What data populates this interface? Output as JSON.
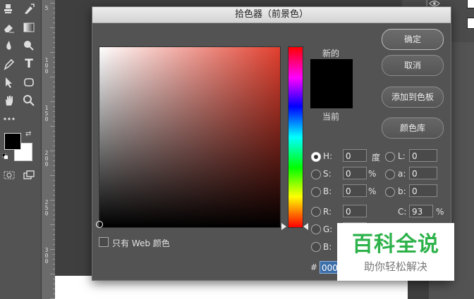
{
  "dialog": {
    "title": "拾色器（前景色）",
    "new_label": "新的",
    "current_label": "当前",
    "buttons": {
      "ok": "确定",
      "cancel": "取消",
      "add_swatches": "添加到色板",
      "color_libraries": "颜色库"
    },
    "web_colors_only": "只有 Web 颜色",
    "hsb": [
      {
        "label": "H:",
        "value": "0",
        "unit": "度",
        "selected": true
      },
      {
        "label": "S:",
        "value": "0",
        "unit": "%",
        "selected": false
      },
      {
        "label": "B:",
        "value": "0",
        "unit": "%",
        "selected": false
      }
    ],
    "lab": [
      {
        "label": "L:",
        "value": "0"
      },
      {
        "label": "a:",
        "value": "0"
      },
      {
        "label": "b:",
        "value": "0"
      }
    ],
    "rgb": [
      {
        "label": "R:",
        "value": "0"
      },
      {
        "label": "G:",
        "value": ""
      },
      {
        "label": "B:",
        "value": ""
      }
    ],
    "cmyk": [
      {
        "label": "C:",
        "value": "93",
        "unit": "%"
      }
    ],
    "hex_label": "#",
    "hex_value": "0000",
    "colors": {
      "foreground": "#000000",
      "hue_base": "#e23f2e"
    }
  },
  "ruler": {
    "numbers": [
      "5",
      "1\n0\n0",
      "1\n5\n0",
      "2\n0\n0",
      "2\n5\n0",
      "3\n0\n0"
    ]
  },
  "watermark": {
    "title": "百科全说",
    "subtitle": "助你轻松解决"
  },
  "toolbar": {
    "tools": [
      "brush-icon",
      "eraser-icon",
      "smudge-icon",
      "pen-icon",
      "path-select-icon",
      "hand-icon",
      "zoom-icon",
      "more-icon"
    ],
    "text_tool": "T"
  }
}
